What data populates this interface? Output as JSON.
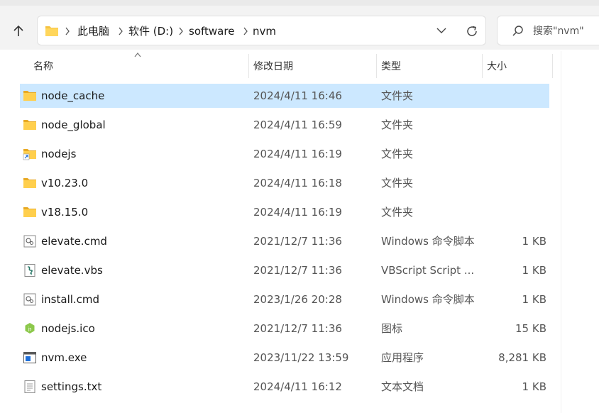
{
  "address": {
    "crumbs": [
      "此电脑",
      "软件 (D:)",
      "software",
      "nvm"
    ]
  },
  "search": {
    "placeholder": "搜索\"nvm\""
  },
  "columns": {
    "name": "名称",
    "date": "修改日期",
    "type": "类型",
    "size": "大小"
  },
  "files": [
    {
      "name": "node_cache",
      "date": "2024/4/11 16:46",
      "type": "文件夹",
      "size": "",
      "icon": "folder-icon",
      "selected": true
    },
    {
      "name": "node_global",
      "date": "2024/4/11 16:59",
      "type": "文件夹",
      "size": "",
      "icon": "folder-icon"
    },
    {
      "name": "nodejs",
      "date": "2024/4/11 16:19",
      "type": "文件夹",
      "size": "",
      "icon": "folder-shortcut-icon"
    },
    {
      "name": "v10.23.0",
      "date": "2024/4/11 16:18",
      "type": "文件夹",
      "size": "",
      "icon": "folder-icon"
    },
    {
      "name": "v18.15.0",
      "date": "2024/4/11 16:19",
      "type": "文件夹",
      "size": "",
      "icon": "folder-icon"
    },
    {
      "name": "elevate.cmd",
      "date": "2021/12/7 11:36",
      "type": "Windows 命令脚本",
      "size": "1 KB",
      "icon": "cmd-file-icon"
    },
    {
      "name": "elevate.vbs",
      "date": "2021/12/7 11:36",
      "type": "VBScript Script ...",
      "size": "1 KB",
      "icon": "vbs-file-icon"
    },
    {
      "name": "install.cmd",
      "date": "2023/1/26 20:28",
      "type": "Windows 命令脚本",
      "size": "1 KB",
      "icon": "cmd-file-icon"
    },
    {
      "name": "nodejs.ico",
      "date": "2021/12/7 11:36",
      "type": "图标",
      "size": "15 KB",
      "icon": "nodejs-ico-icon"
    },
    {
      "name": "nvm.exe",
      "date": "2023/11/22 13:59",
      "type": "应用程序",
      "size": "8,281 KB",
      "icon": "exe-file-icon"
    },
    {
      "name": "settings.txt",
      "date": "2024/4/11 16:12",
      "type": "文本文档",
      "size": "1 KB",
      "icon": "text-file-icon"
    }
  ],
  "colors": {
    "selection": "#cce8ff",
    "folder": "#f5c242"
  }
}
